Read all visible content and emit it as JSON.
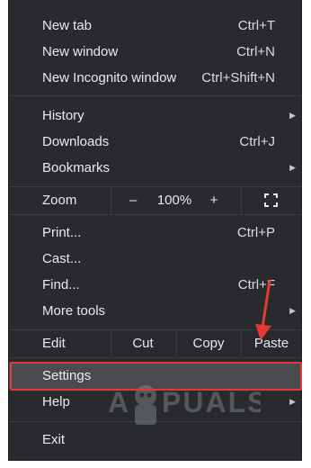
{
  "menu": {
    "new_tab": {
      "label": "New tab",
      "shortcut": "Ctrl+T"
    },
    "new_window": {
      "label": "New window",
      "shortcut": "Ctrl+N"
    },
    "new_incognito": {
      "label": "New Incognito window",
      "shortcut": "Ctrl+Shift+N"
    },
    "history": {
      "label": "History"
    },
    "downloads": {
      "label": "Downloads",
      "shortcut": "Ctrl+J"
    },
    "bookmarks": {
      "label": "Bookmarks"
    },
    "zoom": {
      "label": "Zoom",
      "minus": "–",
      "level": "100%",
      "plus": "+"
    },
    "print": {
      "label": "Print...",
      "shortcut": "Ctrl+P"
    },
    "cast": {
      "label": "Cast..."
    },
    "find": {
      "label": "Find...",
      "shortcut": "Ctrl+F"
    },
    "more_tools": {
      "label": "More tools"
    },
    "edit": {
      "label": "Edit",
      "cut": "Cut",
      "copy": "Copy",
      "paste": "Paste"
    },
    "settings": {
      "label": "Settings"
    },
    "help": {
      "label": "Help"
    },
    "exit": {
      "label": "Exit"
    }
  },
  "watermark_text": "APPUALS",
  "colors": {
    "menu_bg": "#292a2d",
    "text": "#e8eaed",
    "separator": "#3c3d41",
    "hover_bg": "#4a4b4e",
    "annotation_red": "#e53935"
  }
}
